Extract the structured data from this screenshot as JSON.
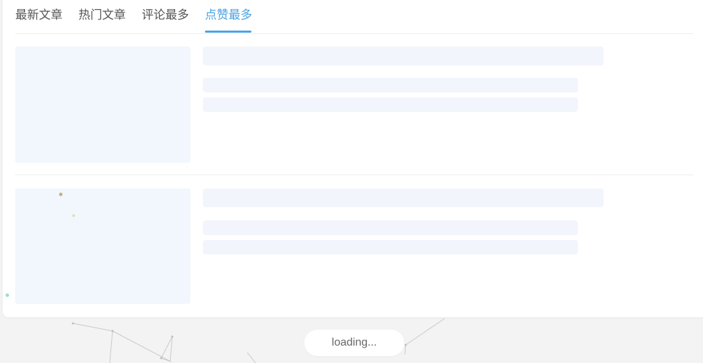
{
  "tabs": [
    {
      "label": "最新文章",
      "active": false
    },
    {
      "label": "热门文章",
      "active": false
    },
    {
      "label": "评论最多",
      "active": false
    },
    {
      "label": "点赞最多",
      "active": true
    }
  ],
  "loading": {
    "text": "loading..."
  },
  "colors": {
    "accent": "#49a3e3",
    "skeleton": "#f2f5fb",
    "tab_text": "#555555"
  }
}
